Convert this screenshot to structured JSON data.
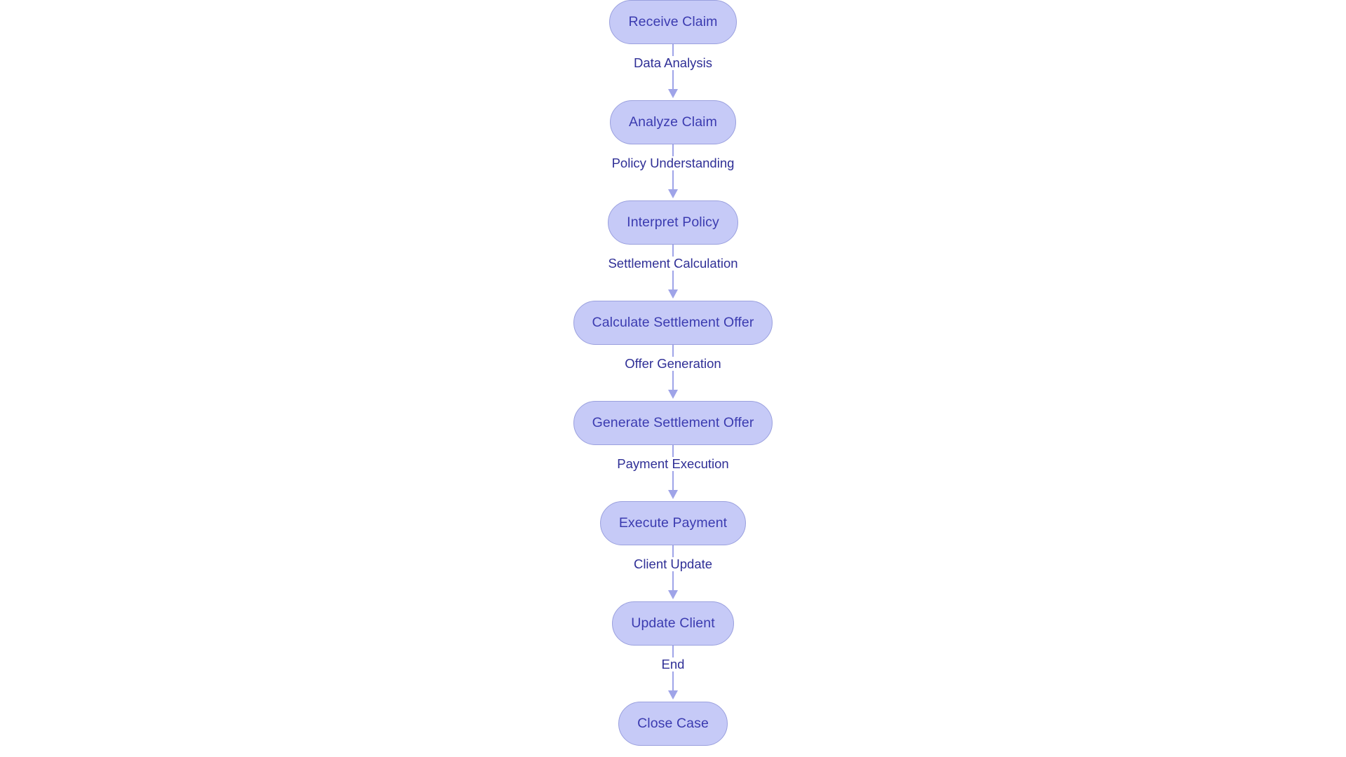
{
  "diagram": {
    "type": "flowchart",
    "orientation": "top-to-bottom",
    "background_color": "#ffffff",
    "node_fill_color": "#c6caf7",
    "node_border_color": "#9aa0de",
    "node_text_color": "#3b3bb0",
    "edge_color": "#9fa4e8",
    "edge_label_color": "#2f2f96",
    "nodes": [
      {
        "id": "receive-claim",
        "label": "Receive Claim"
      },
      {
        "id": "analyze-claim",
        "label": "Analyze Claim"
      },
      {
        "id": "interpret-policy",
        "label": "Interpret Policy"
      },
      {
        "id": "calculate-settlement-offer",
        "label": "Calculate Settlement Offer"
      },
      {
        "id": "generate-settlement-offer",
        "label": "Generate Settlement Offer"
      },
      {
        "id": "execute-payment",
        "label": "Execute Payment"
      },
      {
        "id": "update-client",
        "label": "Update Client"
      },
      {
        "id": "close-case",
        "label": "Close Case"
      }
    ],
    "edges": [
      {
        "from": "receive-claim",
        "to": "analyze-claim",
        "label": "Data Analysis"
      },
      {
        "from": "analyze-claim",
        "to": "interpret-policy",
        "label": "Policy Understanding"
      },
      {
        "from": "interpret-policy",
        "to": "calculate-settlement-offer",
        "label": "Settlement Calculation"
      },
      {
        "from": "calculate-settlement-offer",
        "to": "generate-settlement-offer",
        "label": "Offer Generation"
      },
      {
        "from": "generate-settlement-offer",
        "to": "execute-payment",
        "label": "Payment Execution"
      },
      {
        "from": "execute-payment",
        "to": "update-client",
        "label": "Client Update"
      },
      {
        "from": "update-client",
        "to": "close-case",
        "label": "End"
      }
    ]
  }
}
